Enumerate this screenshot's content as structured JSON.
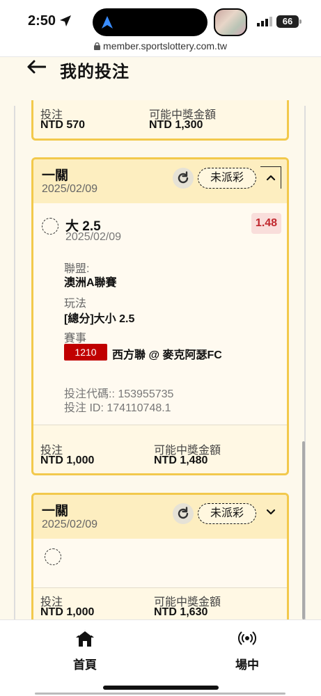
{
  "status_bar": {
    "time": "2:50",
    "battery": "66",
    "url": "member.sportslottery.com.tw"
  },
  "header": {
    "title": "我的投注"
  },
  "cards": [
    {
      "footer": {
        "stake_label": "投注",
        "stake_value": "NTD 570",
        "payout_label": "可能中獎金額",
        "payout_value": "NTD 1,300"
      }
    },
    {
      "bet_type": "一關",
      "date": "2025/02/09",
      "status": "未派彩",
      "selection": {
        "name": "大 2.5",
        "date": "2025/02/09",
        "odds": "1.48",
        "league_label": "聯盟:",
        "league_value": "澳洲A聯賽",
        "market_label": "玩法",
        "market_value": "[總分]大小 2.5",
        "event_label": "賽事",
        "event_id": "1210",
        "event_name": "西方聯 @ 麥克阿瑟FC",
        "bet_code": "投注代碼:: 153955735",
        "bet_id": "投注 ID: 174110748.1"
      },
      "footer": {
        "stake_label": "投注",
        "stake_value": "NTD 1,000",
        "payout_label": "可能中獎金額",
        "payout_value": "NTD 1,480"
      }
    },
    {
      "bet_type": "一關",
      "date": "2025/02/09",
      "status": "未派彩",
      "footer": {
        "stake_label": "投注",
        "stake_value": "NTD 1,000",
        "payout_label": "可能中獎金額",
        "payout_value": "NTD 1,630"
      }
    }
  ],
  "bottom_nav": {
    "home_label": "首頁",
    "live_label": "場中"
  },
  "colors": {
    "card_border": "#f2c94c",
    "card_header": "#fdeec0",
    "odds_text": "#c0272d",
    "event_badge": "#c00000"
  }
}
